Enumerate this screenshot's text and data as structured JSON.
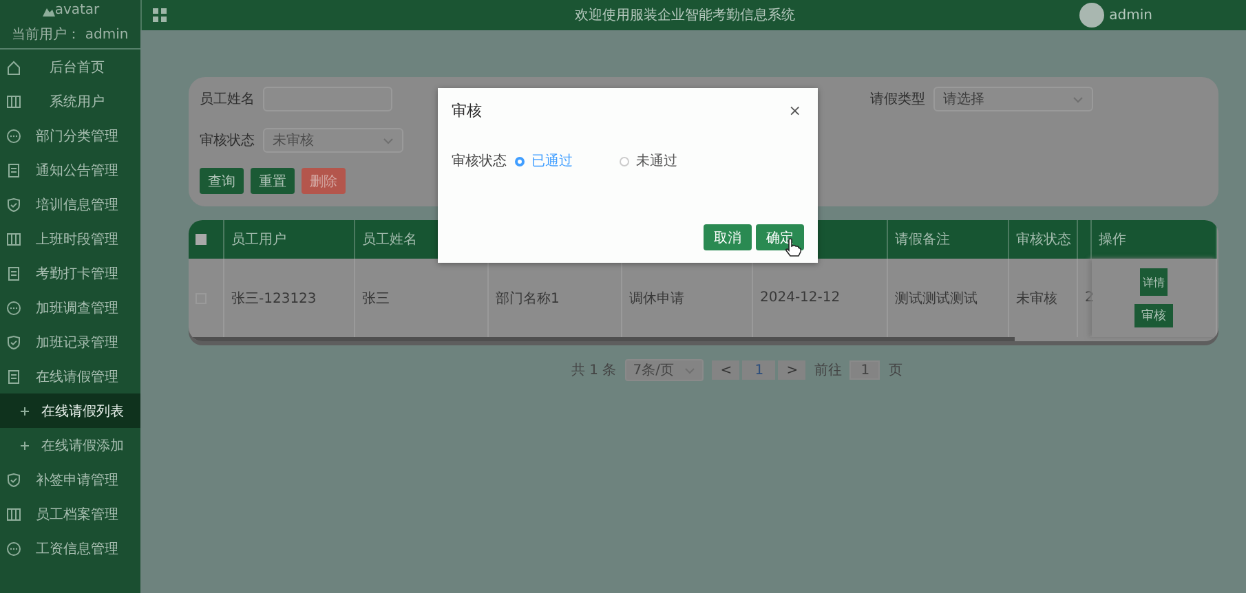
{
  "sidebar": {
    "avatar_alt": "avatar",
    "current_user": "当前用户： admin",
    "items": [
      {
        "label": "后台首页",
        "kind": "menu",
        "selected": false
      },
      {
        "label": "系统用户",
        "kind": "menu",
        "selected": false
      },
      {
        "label": "部门分类管理",
        "kind": "menu",
        "selected": false
      },
      {
        "label": "通知公告管理",
        "kind": "menu",
        "selected": false
      },
      {
        "label": "培训信息管理",
        "kind": "menu",
        "selected": false
      },
      {
        "label": "上班时段管理",
        "kind": "menu",
        "selected": false
      },
      {
        "label": "考勤打卡管理",
        "kind": "menu",
        "selected": false
      },
      {
        "label": "加班调查管理",
        "kind": "menu",
        "selected": false
      },
      {
        "label": "加班记录管理",
        "kind": "menu",
        "selected": false
      },
      {
        "label": "在线请假管理",
        "kind": "menu",
        "selected": false
      },
      {
        "label": "在线请假列表",
        "kind": "sub",
        "selected": true
      },
      {
        "label": "在线请假添加",
        "kind": "sub",
        "selected": false
      },
      {
        "label": "补签申请管理",
        "kind": "menu",
        "selected": false
      },
      {
        "label": "员工档案管理",
        "kind": "menu",
        "selected": false
      },
      {
        "label": "工资信息管理",
        "kind": "menu",
        "selected": false
      }
    ]
  },
  "topbar": {
    "title": "欢迎使用服装企业智能考勤信息系统",
    "user": "admin"
  },
  "search": {
    "fields": [
      {
        "label": "员工姓名",
        "kind": "input"
      },
      {
        "label": "请假类型",
        "kind": "select",
        "placeholder": "请选择"
      },
      {
        "label": "审核状态",
        "kind": "select",
        "value": "未审核"
      }
    ],
    "buttons": [
      {
        "label": "查询",
        "kind": "primary"
      },
      {
        "label": "重置",
        "kind": "primary"
      },
      {
        "label": "删除",
        "kind": "danger"
      }
    ]
  },
  "table": {
    "all_checked": false,
    "columns": [
      "员工用户",
      "员工姓名",
      null,
      null,
      null,
      "请假备注",
      "审核状态",
      null,
      "操作"
    ],
    "rows": [
      {
        "checked": false,
        "cells": [
          "张三-123123",
          "张三",
          "部门名称1",
          "调休申请",
          "2024-12-12",
          "测试测试测试",
          "未审核",
          "2"
        ],
        "actions": [
          "详情",
          "审核"
        ]
      }
    ]
  },
  "pagination": {
    "total": "共 1 条",
    "page_size": "7条/页",
    "prev": "<",
    "page": "1",
    "next": ">",
    "goto_label": "前往",
    "goto_value": "1",
    "goto_suffix": "页"
  },
  "modal": {
    "title": "审核",
    "close": "×",
    "field_label": "审核状态",
    "options": [
      {
        "label": "已通过",
        "selected": true
      },
      {
        "label": "未通过",
        "selected": false
      }
    ],
    "buttons": [
      {
        "label": "取消"
      },
      {
        "label": "确定"
      }
    ]
  }
}
